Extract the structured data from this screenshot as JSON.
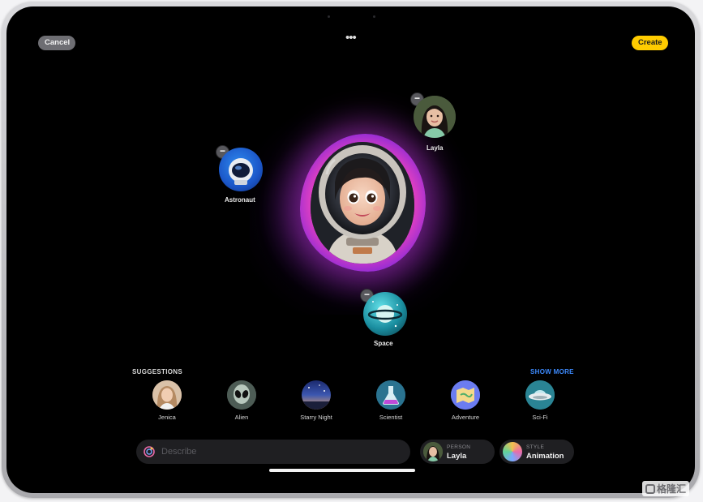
{
  "toolbar": {
    "cancel_label": "Cancel",
    "create_label": "Create",
    "more_icon": "ellipsis-icon"
  },
  "concepts": {
    "astronaut_label": "Astronaut",
    "layla_label": "Layla",
    "space_label": "Space"
  },
  "suggestions": {
    "title": "SUGGESTIONS",
    "show_more_label": "SHOW MORE",
    "items": [
      {
        "label": "Jenica"
      },
      {
        "label": "Alien"
      },
      {
        "label": "Starry Night"
      },
      {
        "label": "Scientist"
      },
      {
        "label": "Adventure"
      },
      {
        "label": "Sci-Fi"
      }
    ]
  },
  "describe": {
    "placeholder": "Describe"
  },
  "person_pill": {
    "caption": "PERSON",
    "value": "Layla"
  },
  "style_pill": {
    "caption": "STYLE",
    "value": "Animation"
  },
  "watermark": "格隆汇",
  "colors": {
    "create_accent": "#ffcc00",
    "show_more_accent": "#3d8bff",
    "glow": "#e03fc2"
  }
}
